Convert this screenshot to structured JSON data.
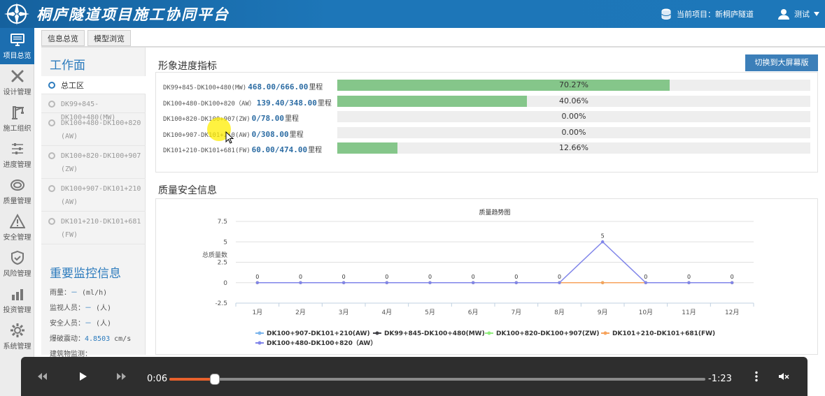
{
  "header": {
    "title": "桐庐隧道项目施工协同平台",
    "project_label": "当前项目：新桐庐隧道",
    "user_name": "测试"
  },
  "nav": [
    {
      "label": "项目总览",
      "icon": "monitor-icon",
      "active": true
    },
    {
      "label": "设计管理",
      "icon": "tools-icon",
      "active": false
    },
    {
      "label": "施工组织",
      "icon": "crane-icon",
      "active": false
    },
    {
      "label": "进度管理",
      "icon": "sliders-icon",
      "active": false
    },
    {
      "label": "质量管理",
      "icon": "quality-icon",
      "active": false
    },
    {
      "label": "安全管理",
      "icon": "warning-icon",
      "active": false
    },
    {
      "label": "风险管理",
      "icon": "shield-check-icon",
      "active": false
    },
    {
      "label": "投资管理",
      "icon": "investment-icon",
      "active": false
    },
    {
      "label": "系统管理",
      "icon": "gear-icon",
      "active": false
    }
  ],
  "tabs": [
    {
      "label": "信息总览",
      "active": true
    },
    {
      "label": "模型浏览",
      "active": false
    }
  ],
  "workface": {
    "title": "工作面",
    "items": [
      "总工区",
      "DK99+845-DK100+480(MW)",
      "DK100+480-DK100+820\n(AW)",
      "DK100+820-DK100+907\n(ZW)",
      "DK100+907-DK101+210\n(AW)",
      "DK101+210-DK101+681\n(FW)"
    ]
  },
  "monitor": {
    "title": "重要监控信息",
    "rows": [
      {
        "label": "雨量：",
        "value": "－",
        "unit": "(ml/h)"
      },
      {
        "label": "监视人员：",
        "value": "－",
        "unit": "(人)"
      },
      {
        "label": "安全人员：",
        "value": "－",
        "unit": "(人)"
      },
      {
        "label": "爆破震动：",
        "value": "4.8503",
        "unit": "cm/s"
      },
      {
        "label": "建筑物监测：",
        "value": "",
        "unit": ""
      }
    ]
  },
  "progress": {
    "title": "形象进度指标",
    "switch_label": "切换到大屏幕版",
    "unit": "里程",
    "rows": [
      {
        "name": "DK99+845-DK100+480(MW)",
        "value": "468.00/666.00",
        "fraction": 0.7027,
        "pct": "70.27%"
      },
      {
        "name": "DK100+480-DK100+820（AW）",
        "value": "139.40/348.00",
        "fraction": 0.4006,
        "pct": "40.06%"
      },
      {
        "name": "DK100+820-DK100+907(ZW)",
        "value": "0/78.00",
        "fraction": 0,
        "pct": "0.00%"
      },
      {
        "name": "DK100+907-DK101+210(AW)",
        "value": "0/308.00",
        "fraction": 0,
        "pct": "0.00%"
      },
      {
        "name": "DK101+210-DK101+681(FW)",
        "value": "60.00/474.00",
        "fraction": 0.1266,
        "pct": "12.66%"
      }
    ]
  },
  "quality": {
    "title": "质量安全信息"
  },
  "chart_data": {
    "type": "line",
    "title": "质量趋势图",
    "xlabel": "",
    "ylabel": "总质量数",
    "categories": [
      "1月",
      "2月",
      "3月",
      "4月",
      "5月",
      "6月",
      "7月",
      "8月",
      "9月",
      "10月",
      "11月",
      "12月"
    ],
    "ylim": [
      -2.5,
      7.5
    ],
    "yticks": [
      7.5,
      5,
      2.5,
      0,
      -2.5
    ],
    "grid": true,
    "legend_position": "bottom",
    "series": [
      {
        "name": "DK100+907-DK101+210(AW)",
        "color": "#7cb5ec",
        "values": [
          0,
          0,
          0,
          0,
          0,
          0,
          0,
          0,
          0,
          0,
          0,
          0
        ]
      },
      {
        "name": "DK99+845-DK100+480(MW)",
        "color": "#434348",
        "values": [
          0,
          0,
          0,
          0,
          0,
          0,
          0,
          0,
          0,
          0,
          0,
          0
        ]
      },
      {
        "name": "DK100+820-DK100+907(ZW)",
        "color": "#90ed7d",
        "values": [
          0,
          0,
          0,
          0,
          0,
          0,
          0,
          0,
          0,
          0,
          0,
          0
        ]
      },
      {
        "name": "DK101+210-DK101+681(FW)",
        "color": "#f7a35c",
        "values": [
          0,
          0,
          0,
          0,
          0,
          0,
          0,
          0,
          0,
          0,
          0,
          0
        ]
      },
      {
        "name": "DK100+480-DK100+820（AW）",
        "color": "#8085e9",
        "values": [
          0,
          0,
          0,
          0,
          0,
          0,
          0,
          0,
          5,
          0,
          0,
          0
        ]
      }
    ]
  },
  "video": {
    "current_time": "0:06",
    "remaining_time": "-1:23",
    "progress_fraction": 0.085
  }
}
